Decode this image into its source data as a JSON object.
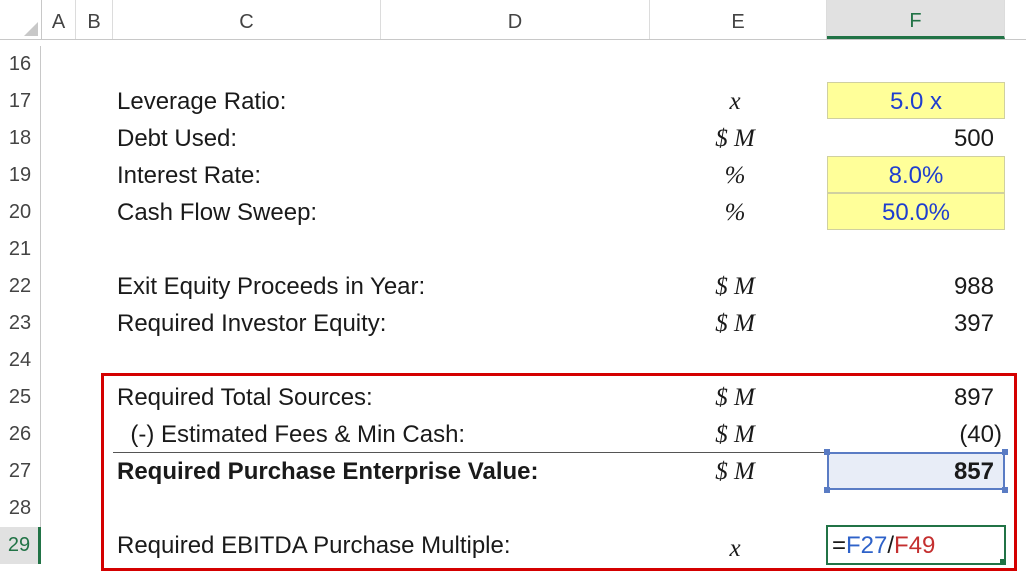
{
  "columns": [
    "A",
    "B",
    "C",
    "D",
    "E",
    "F"
  ],
  "selected_column": "F",
  "rows": [
    "16",
    "17",
    "18",
    "19",
    "20",
    "21",
    "22",
    "23",
    "24",
    "25",
    "26",
    "27",
    "28",
    "29"
  ],
  "selected_row": "29",
  "cells": {
    "r17": {
      "label": "Leverage Ratio:",
      "unit": "x",
      "value": "5.0 x"
    },
    "r18": {
      "label": "Debt Used:",
      "unit": "$ M",
      "value": "500"
    },
    "r19": {
      "label": "Interest Rate:",
      "unit": "%",
      "value": "8.0%"
    },
    "r20": {
      "label": "Cash Flow Sweep:",
      "unit": "%",
      "value": "50.0%"
    },
    "r22": {
      "label": "Exit Equity Proceeds in Year:",
      "unit": "$ M",
      "value": "988"
    },
    "r23": {
      "label": "Required Investor Equity:",
      "unit": "$ M",
      "value": "397"
    },
    "r25": {
      "label": "Required Total Sources:",
      "unit": "$ M",
      "value": "897"
    },
    "r26": {
      "label": "  (-) Estimated Fees & Min Cash:",
      "unit": "$ M",
      "value": "(40)"
    },
    "r27": {
      "label": "Required Purchase Enterprise Value:",
      "unit": "$ M",
      "value": "857"
    },
    "r29": {
      "label": "Required EBITDA Purchase Multiple:",
      "unit": "x"
    }
  },
  "formula": {
    "eq": "=",
    "ref1": "F27",
    "op": "/",
    "ref2": "F49"
  },
  "colors": {
    "input_fill": "#ffff99",
    "input_text": "#1f3ecf",
    "highlight_border": "#d40000",
    "excel_green": "#217346",
    "ref1_color": "#2e62c9",
    "ref2_color": "#c42f2f"
  }
}
